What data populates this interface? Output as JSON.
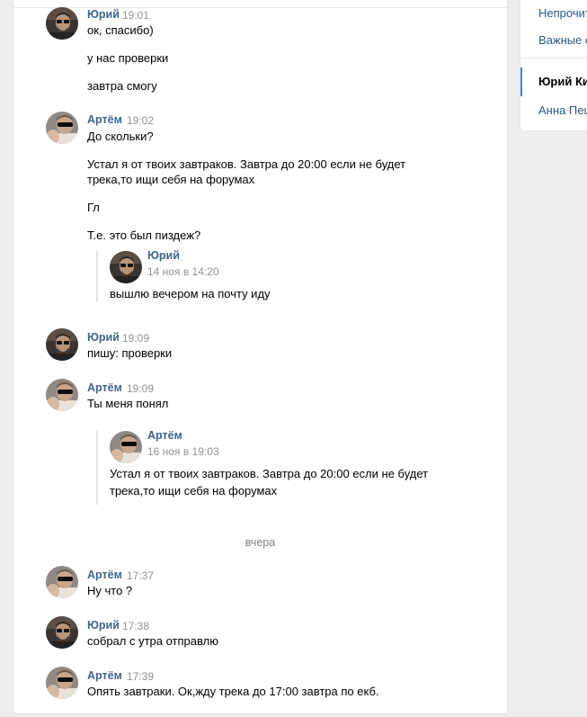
{
  "right_panel": {
    "items": [
      {
        "label": "Непрочит"
      },
      {
        "label": "Важные с"
      },
      {
        "label": "Юрий Ки"
      },
      {
        "label": "Анна Пец"
      }
    ],
    "active_index": 2
  },
  "messages": [
    {
      "author": "Юрий",
      "time": "19:01",
      "lines": [
        "ок, спасибо)",
        "у нас проверки",
        "завтра смогу"
      ]
    },
    {
      "author": "Артём",
      "time": "19:02",
      "lines": [
        "До скольки?",
        "Устал я от твоих завтраков. Завтра до 20:00 если не будет",
        "трека,то ищи себя на форумах",
        "Гл",
        "Т.е. это был пиздеж?"
      ],
      "forwarded": {
        "author": "Юрий",
        "time": "14 ноя в 14:20",
        "lines": [
          "вышлю вечером на почту иду"
        ]
      }
    },
    {
      "author": "Юрий",
      "time": "19:09",
      "lines": [
        "пишу: проверки"
      ]
    },
    {
      "author": "Артём",
      "time": "19:09",
      "lines": [
        "Ты меня понял"
      ],
      "forwarded": {
        "author": "Артём",
        "time": "16 ноя в 19:03",
        "lines": [
          "Устал я от твоих завтраков. Завтра до 20:00 если не будет",
          "трека,то ищи себя на форумах"
        ]
      }
    },
    {
      "author": "Артём",
      "time": "17:37",
      "lines": [
        "Ну что ?"
      ]
    },
    {
      "author": "Юрий",
      "time": "17:38",
      "lines": [
        "собрал с утра отправлю"
      ]
    },
    {
      "author": "Артём",
      "time": "17:39",
      "lines": [
        "Опять завтраки. Ок,жду трека до 17:00 завтра по екб."
      ]
    }
  ],
  "date_separator": "вчера",
  "colors": {
    "author": "#42648b",
    "time": "#939393",
    "link": "#2a5885",
    "page_bg": "#edeef0"
  }
}
